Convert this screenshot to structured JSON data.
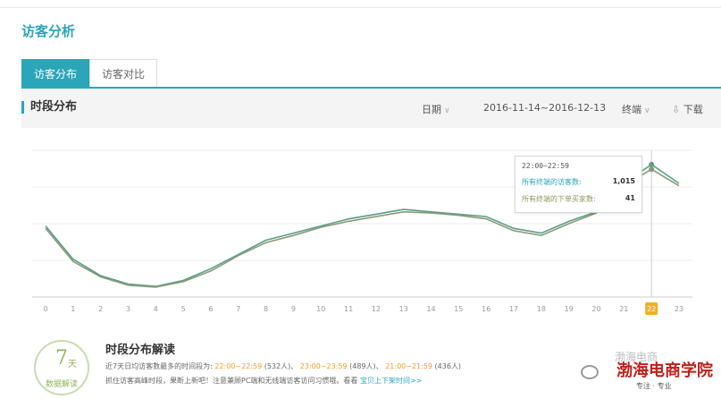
{
  "page": {
    "title": "访客分析"
  },
  "tabs": [
    {
      "label": "访客分布",
      "active": true
    },
    {
      "label": "访客对比",
      "active": false
    }
  ],
  "section": {
    "title": "时段分布",
    "date_label": "日期",
    "date_range": "2016-11-14~2016-12-13",
    "terminal_label": "终端",
    "download_label": "下载"
  },
  "tooltip": {
    "time": "22:00~22:59",
    "row1_label": "所有终端的访客数:",
    "row1_value": "1,015",
    "row2_label": "所有终端的下单买家数:",
    "row2_value": "41"
  },
  "summary": {
    "badge_number": "7",
    "badge_unit": "天",
    "badge_sub": "数据解读",
    "title": "时段分布解读",
    "line1_prefix": "近7天日均访客数最多的时间段为:",
    "slot1": "22:00~22:59",
    "slot1_count": "(532人)、",
    "slot2": "23:00~23:59",
    "slot2_count": "(489人)、",
    "slot3": "21:00~21:59",
    "slot3_count": "(436人)",
    "line2_text": "抓住访客高峰时段，果断上新吧！注意兼顾PC端和无线端访客访问习惯哦。看看",
    "line2_link": "宝贝上下架时间>>"
  },
  "watermark": {
    "text": "渤海电商学院",
    "sub": "专注 · 专业",
    "ghost": "渤海电商"
  },
  "chart_data": {
    "type": "line",
    "x": [
      "0",
      "1",
      "2",
      "3",
      "4",
      "5",
      "6",
      "7",
      "8",
      "9",
      "10",
      "11",
      "12",
      "13",
      "14",
      "15",
      "16",
      "17",
      "18",
      "19",
      "20",
      "21",
      "22",
      "23"
    ],
    "highlight_x": "22",
    "colors": {
      "series_a": "#5a9e8a",
      "series_b": "#8a9a78",
      "highlight": "#f0b020"
    },
    "series": [
      {
        "values": [
          300,
          160,
          90,
          55,
          45,
          70,
          120,
          180,
          240,
          270,
          300,
          330,
          350,
          370,
          360,
          350,
          340,
          290,
          270,
          320,
          360,
          480,
          560,
          480
        ]
      },
      {
        "values": [
          290,
          150,
          85,
          50,
          42,
          65,
          110,
          175,
          230,
          260,
          295,
          320,
          340,
          360,
          355,
          345,
          330,
          280,
          260,
          310,
          355,
          470,
          540,
          470
        ]
      }
    ],
    "ylim": [
      0,
      620
    ],
    "grid": true
  }
}
